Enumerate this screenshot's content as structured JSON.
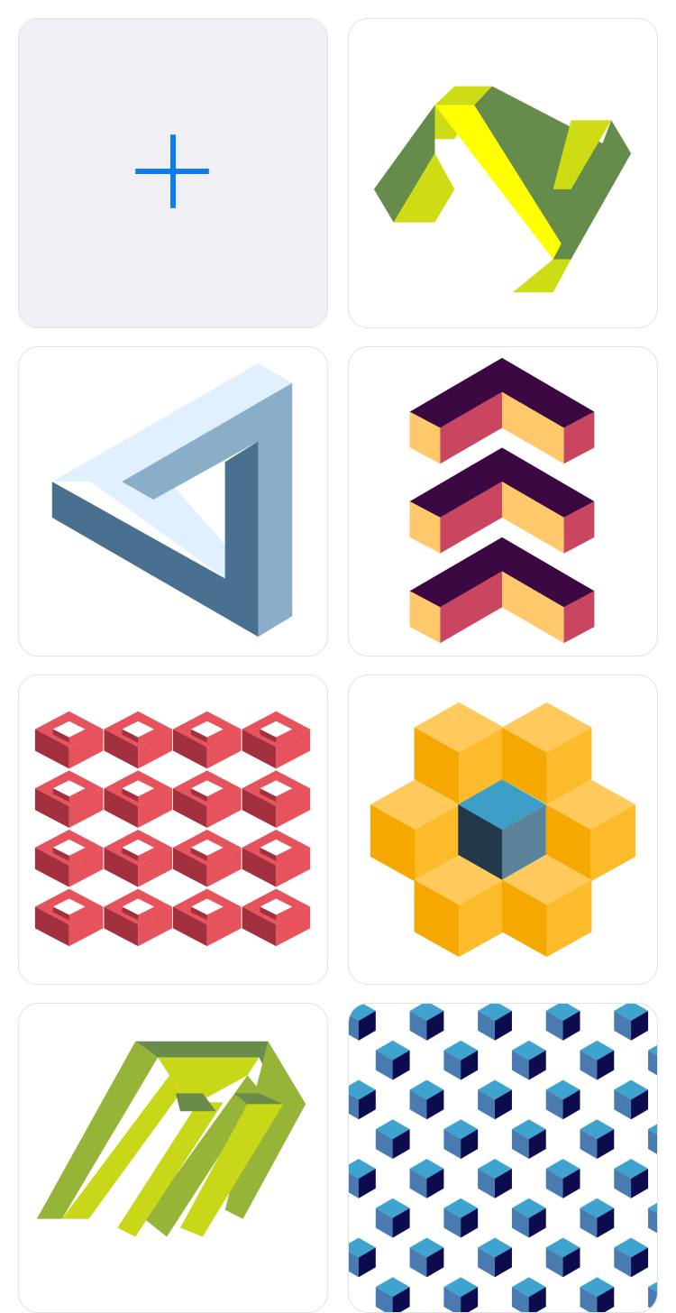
{
  "gallery": {
    "add_tile": {
      "icon": "plus-icon",
      "accent": "#0a7cf0"
    },
    "tiles": [
      {
        "icon": "zigzag-ribbon-pattern",
        "colors": [
          "#658c4a",
          "#ffff00",
          "#cedc16"
        ]
      },
      {
        "icon": "impossible-triangle-pattern",
        "colors": [
          "#e0f0ff",
          "#8aaec7",
          "#49708e"
        ]
      },
      {
        "icon": "stacked-chevrons-pattern",
        "colors": [
          "#3b0842",
          "#c94560",
          "#ffc86a"
        ]
      },
      {
        "icon": "isometric-lattice-pattern",
        "colors": [
          "#e7535d",
          "#a3303f",
          "#ffffff"
        ]
      },
      {
        "icon": "cube-flower-pattern",
        "colors": [
          "#ffc95c",
          "#f5a800",
          "#3d9fc8",
          "#23384a"
        ]
      },
      {
        "icon": "impossible-frame-pattern",
        "colors": [
          "#96b538",
          "#6a8c4a",
          "#c8d818"
        ]
      },
      {
        "icon": "hexagon-cube-tiling-pattern",
        "colors": [
          "#0b0b4d",
          "#4a7bb0",
          "#3ea3cf",
          "#ffffff"
        ]
      }
    ]
  }
}
